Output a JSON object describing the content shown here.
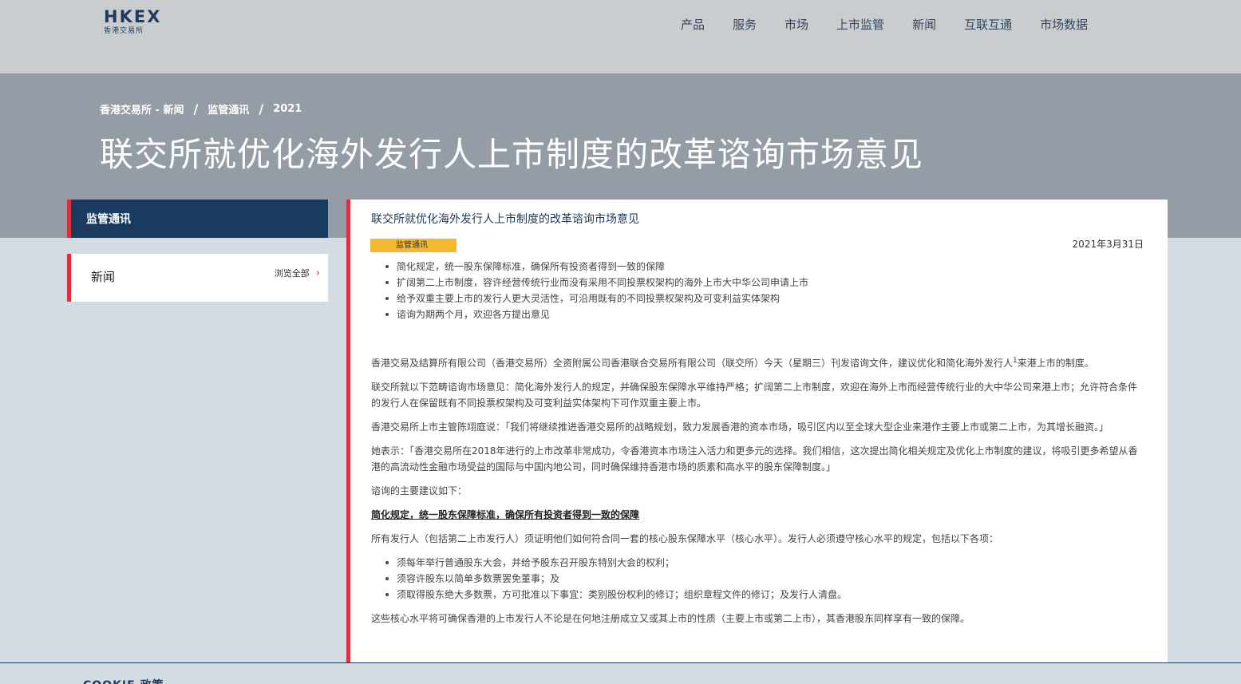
{
  "header": {
    "logo_main": "HKEX",
    "logo_sub": "香港交易所",
    "nav": [
      "产品",
      "服务",
      "市场",
      "上市监管",
      "新闻",
      "互联互通",
      "市场数据"
    ]
  },
  "banner": {
    "breadcrumb": [
      "香港交易所 - 新闻",
      "监管通讯",
      "2021"
    ],
    "separator": "/",
    "title": "联交所就优化海外发行人上市制度的改革谘询市场意见"
  },
  "sidebar": {
    "active_label": "监管通讯",
    "news_label": "新闻",
    "browse_all": "浏览全部",
    "chevron": "›"
  },
  "article": {
    "title": "联交所就优化海外发行人上市制度的改革谘询市场意见",
    "tag": "监管通讯",
    "date": "2021年3月31日",
    "highlights": [
      "简化规定，统一股东保障标准，确保所有投资者得到一致的保障",
      "扩阔第二上市制度，容许经营传统行业而没有采用不同投票权架构的海外上市大中华公司申请上市",
      "给予双重主要上市的发行人更大灵活性，可沿用既有的不同投票权架构及可变利益实体架构",
      "谘询为期两个月，欢迎各方提出意见"
    ],
    "p1_a": "香港交易及结算所有限公司（香港交易所）全资附属公司香港联合交易所有限公司（联交所）今天（星期三）刊发谘询文件，建议优化和简化海外发行人",
    "p1_sup": "1",
    "p1_b": "来港上市的制度。",
    "p2": "联交所就以下范畴谘询市场意见：简化海外发行人的规定，并确保股东保障水平维持严格；扩阔第二上市制度，欢迎在海外上市而经营传统行业的大中华公司来港上市；允许符合条件的发行人在保留既有不同投票权架构及可变利益实体架构下可作双重主要上市。",
    "p3": "香港交易所上市主管陈翊庭说：「我们将继续推进香港交易所的战略规划，致力发展香港的资本市场，吸引区内以至全球大型企业来港作主要上市或第二上市，为其增长融资。」",
    "p4": "她表示：「香港交易所在2018年进行的上市改革非常成功，令香港资本市场注入活力和更多元的选择。我们相信，这次提出简化相关规定及优化上市制度的建议，将吸引更多希望从香港的高流动性金融市场受益的国际与中国内地公司，同时确保维持香港市场的质素和高水平的股东保障制度。」",
    "p5": "谘询的主要建议如下：",
    "subheading": "简化规定，统一股东保障标准，确保所有投资者得到一致的保障",
    "p6": "所有发行人（包括第二上市发行人）须证明他们如何符合同一套的核心股东保障水平（核心水平）。发行人必须遵守核心水平的规定，包括以下各项：",
    "core_items": [
      "须每年举行普通股东大会，并给予股东召开股东特别大会的权利；",
      "须容许股东以简单多数票罢免董事；及",
      "须取得股东绝大多数票，方可批准以下事宜：类别股份权利的修订；组织章程文件的修订；及发行人清盘。"
    ],
    "p7": "这些核心水平将可确保香港的上市发行人不论是在何地注册成立又或其上市的性质（主要上市或第二上市），其香港股东同样享有一致的保障。"
  },
  "footer": {
    "label": "COOKIE 政策"
  }
}
